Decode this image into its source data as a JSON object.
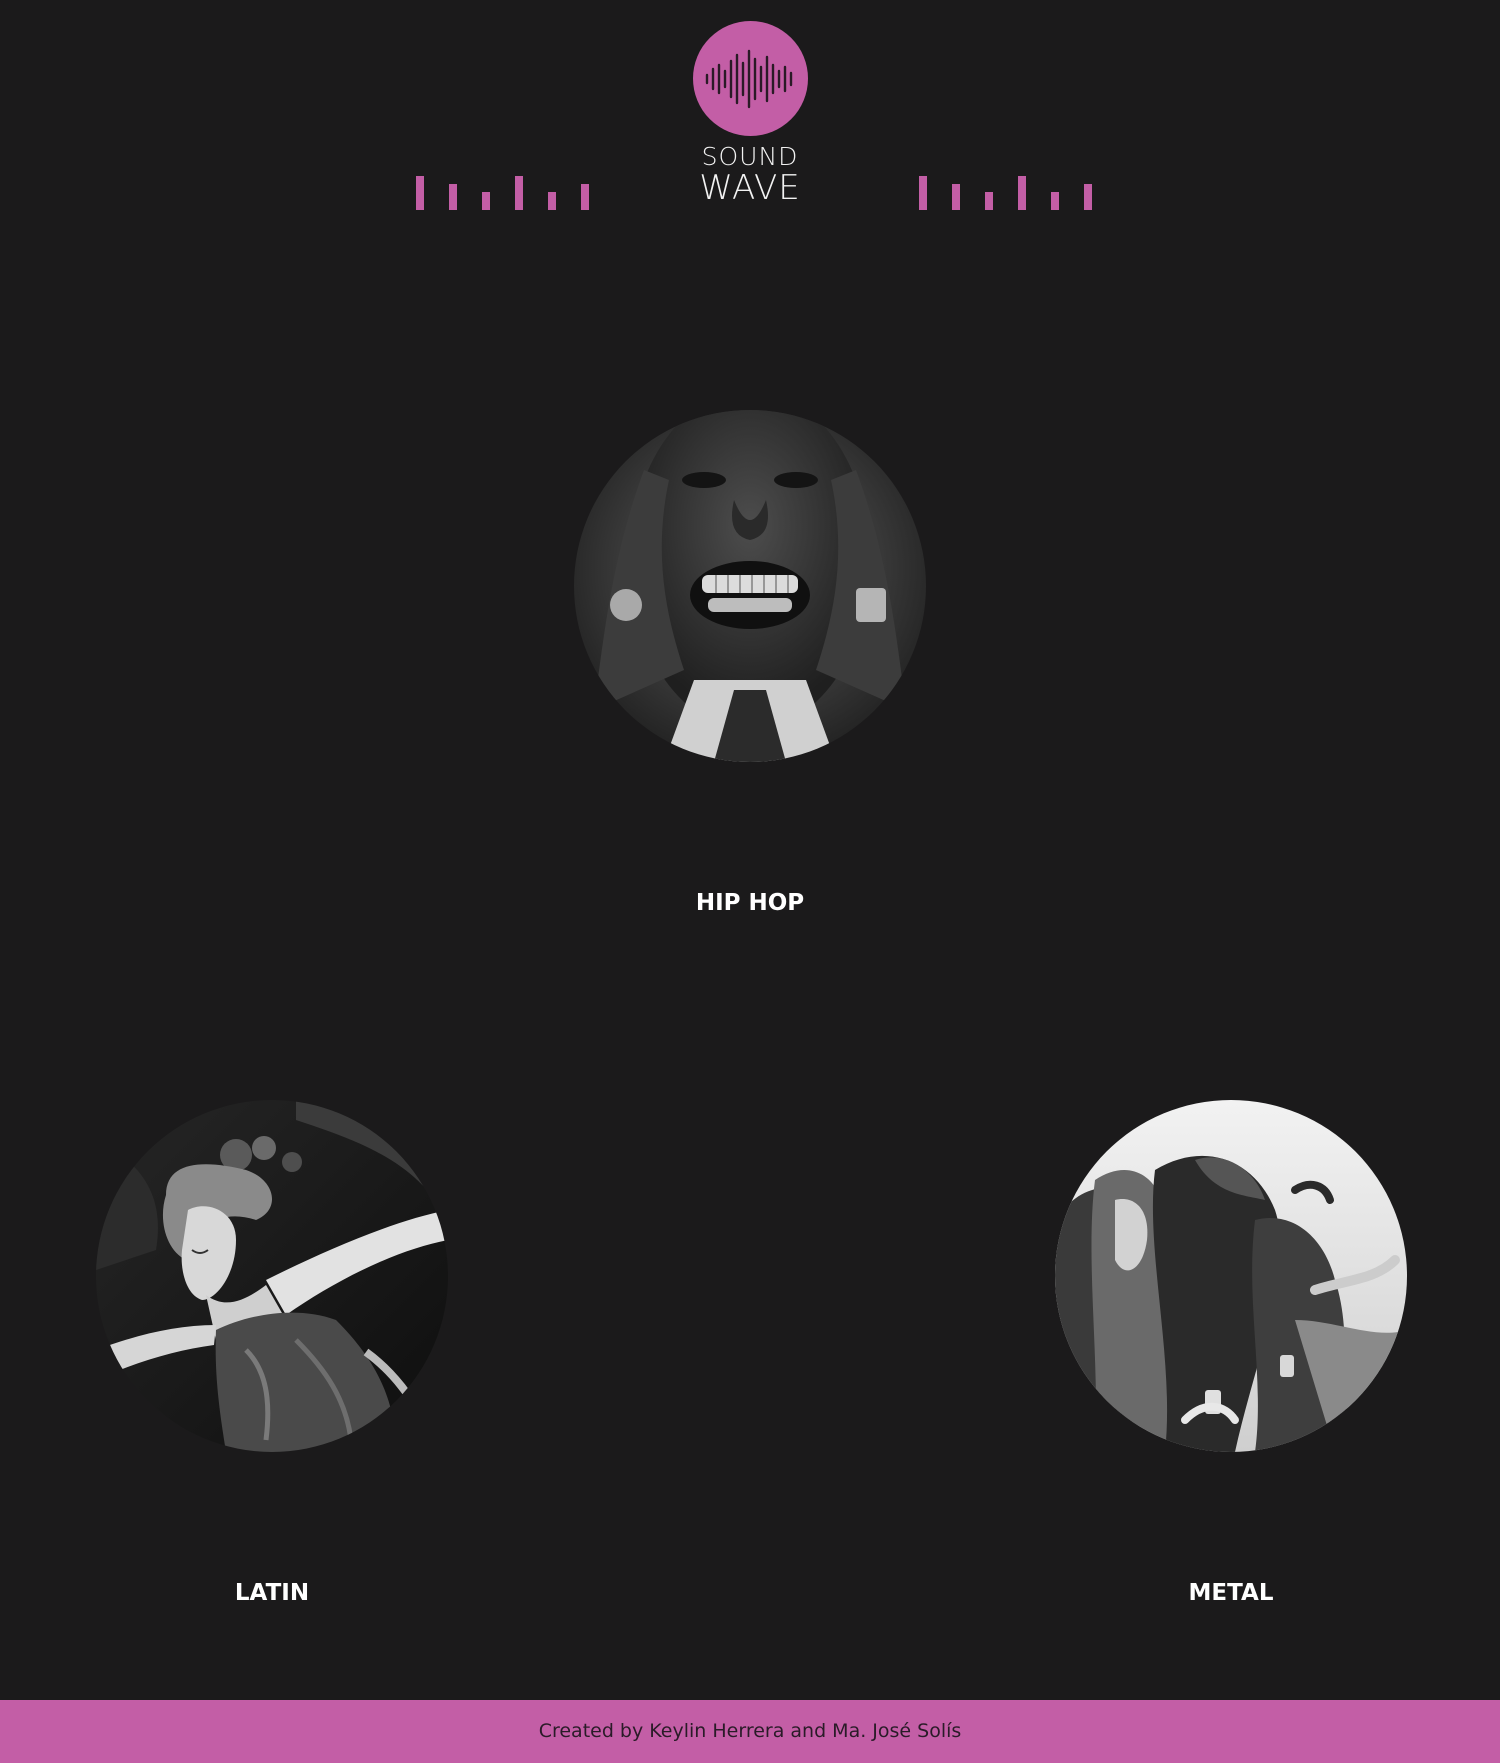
{
  "header": {
    "logo_icon": "soundwave-icon",
    "brand_line1": "SOUND",
    "brand_line2": "WAVE",
    "accent_color": "#c35ea6"
  },
  "genres": [
    {
      "label": "HIP HOP",
      "image": "portrait-grillz-photo"
    },
    {
      "label": "LATIN",
      "image": "dancer-painting"
    },
    {
      "label": "METAL",
      "image": "concert-crowd-photo"
    }
  ],
  "footer": {
    "credit": "Created by Keylin Herrera and Ma. José Solís"
  }
}
